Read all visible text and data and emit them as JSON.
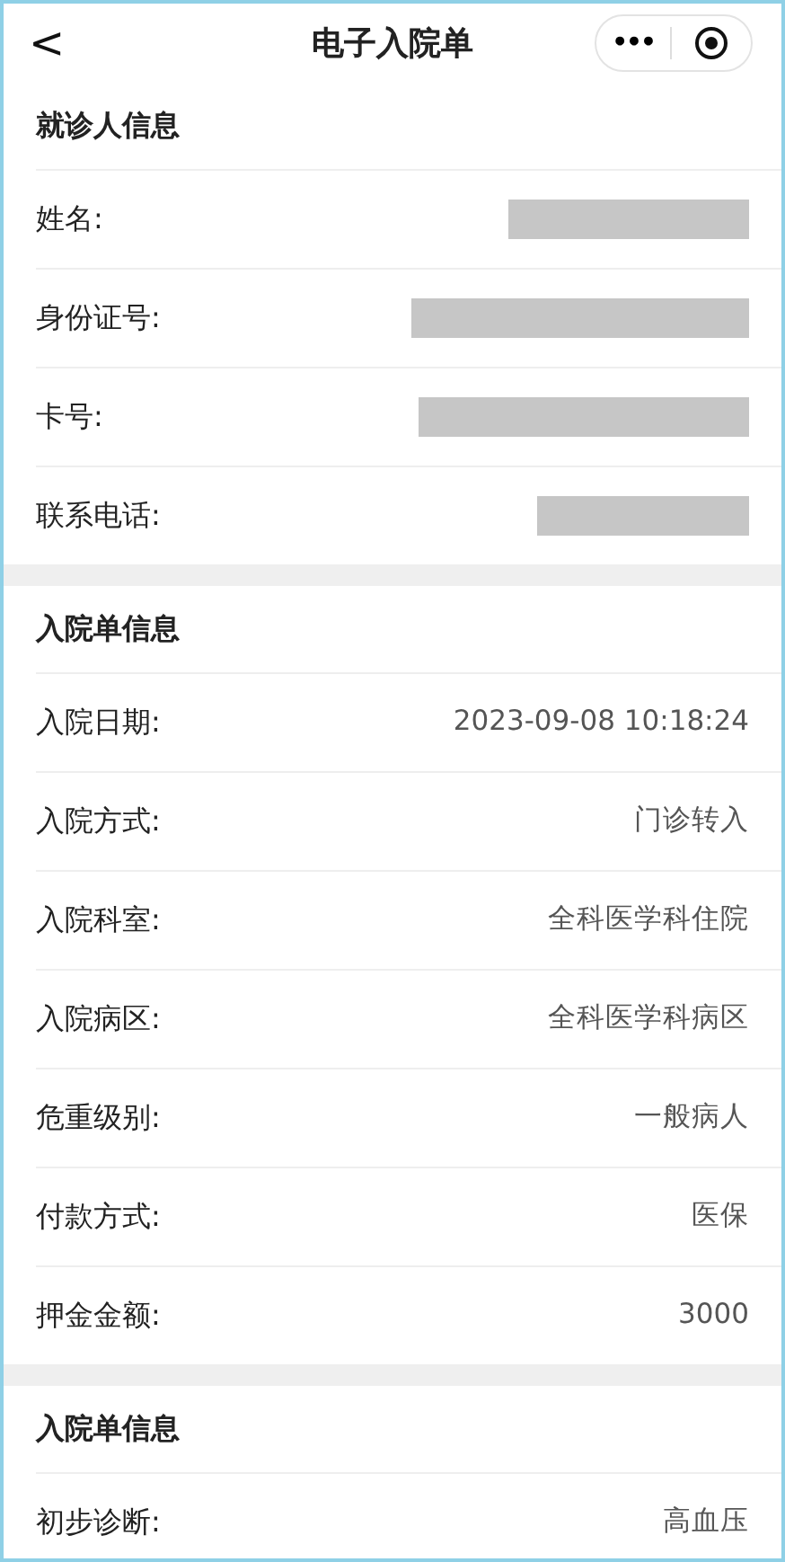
{
  "header": {
    "back": "<",
    "title": "电子入院单",
    "more": "•••"
  },
  "sections": [
    {
      "title": "就诊人信息",
      "rows": [
        {
          "label": "姓名:",
          "redacted": true
        },
        {
          "label": "身份证号:",
          "redacted": true
        },
        {
          "label": "卡号:",
          "redacted": true
        },
        {
          "label": "联系电话:",
          "redacted": true
        }
      ]
    },
    {
      "title": "入院单信息",
      "rows": [
        {
          "label": "入院日期:",
          "value": "2023-09-08 10:18:24"
        },
        {
          "label": "入院方式:",
          "value": "门诊转入"
        },
        {
          "label": "入院科室:",
          "value": "全科医学科住院"
        },
        {
          "label": "入院病区:",
          "value": "全科医学科病区"
        },
        {
          "label": "危重级别:",
          "value": "一般病人"
        },
        {
          "label": "付款方式:",
          "value": "医保"
        },
        {
          "label": "押金金额:",
          "value": "3000"
        }
      ]
    },
    {
      "title": "入院单信息",
      "rows": [
        {
          "label": "初步诊断:",
          "value": "高血压"
        }
      ]
    }
  ]
}
